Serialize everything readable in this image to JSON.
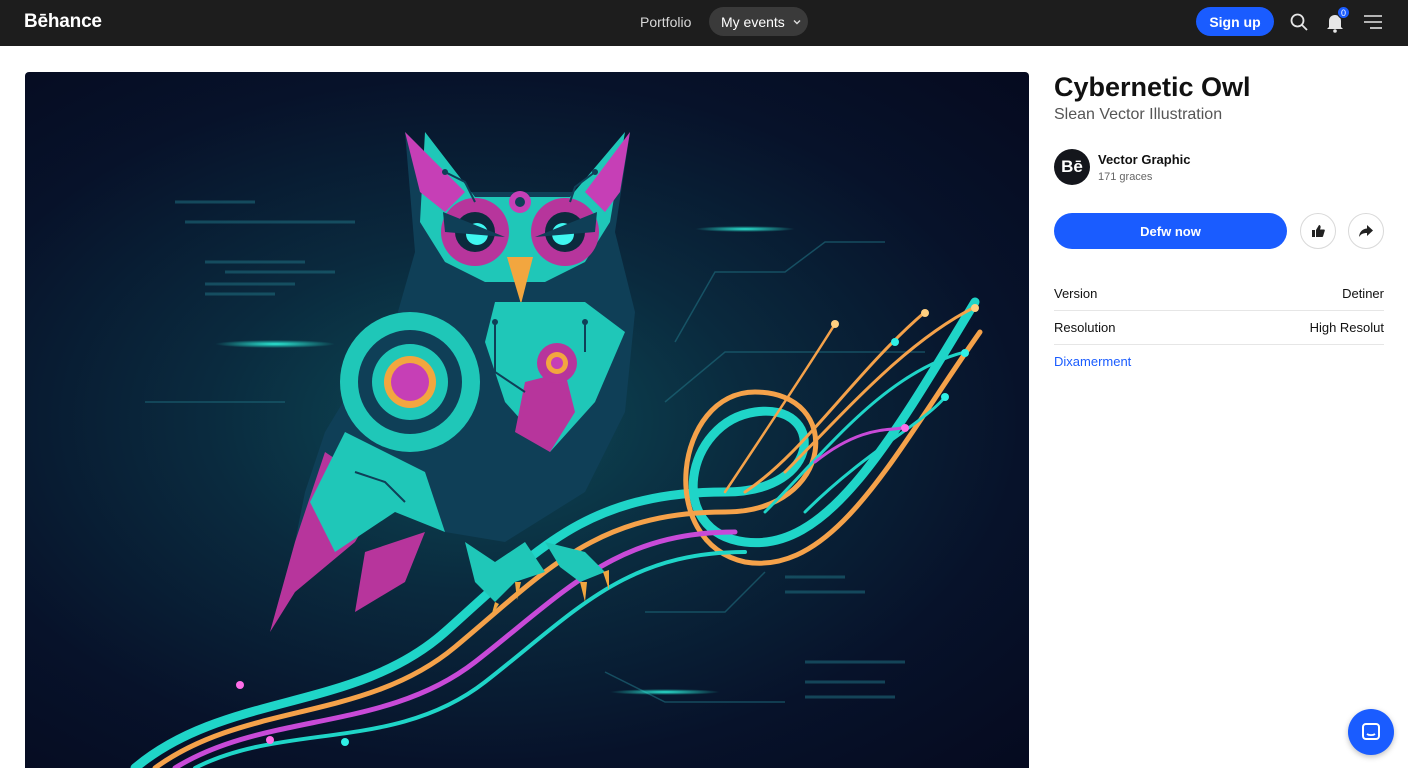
{
  "nav": {
    "logo": "Bēhance",
    "portfolio": "Portfolio",
    "my_events": "My events",
    "sign_up": "Sign up",
    "notification_count": "0"
  },
  "project": {
    "title": "Cybernetic Owl",
    "subtitle": "Slean Vector Illustration",
    "image_alt": "Cybernetic owl vector illustration"
  },
  "author": {
    "avatar_text": "Bē",
    "name": "Vector Graphic",
    "meta": "171 graces"
  },
  "actions": {
    "primary": "Defw now"
  },
  "details": [
    {
      "key": "Version",
      "value": "Detiner"
    },
    {
      "key": "Resolution",
      "value": "High Resolut"
    }
  ],
  "link": "Dixamerment",
  "colors": {
    "accent": "#1a5cff",
    "topbar": "#1d1d1d"
  }
}
